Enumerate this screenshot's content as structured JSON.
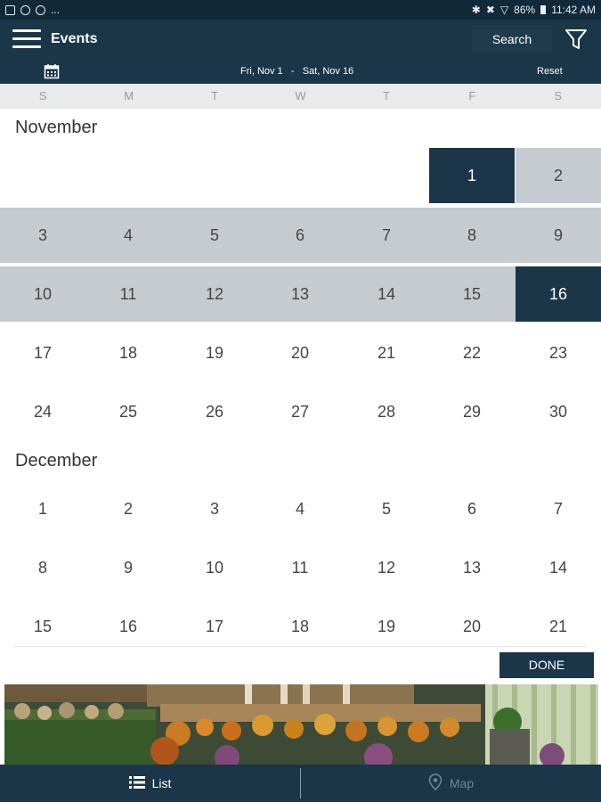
{
  "status_bar": {
    "left_text": "...",
    "battery": "86%",
    "time": "11:42 AM"
  },
  "header": {
    "title": "Events",
    "search_label": "Search"
  },
  "range_bar": {
    "start": "Fri, Nov 1",
    "separator": "-",
    "end": "Sat, Nov 16",
    "reset_label": "Reset"
  },
  "weekdays": [
    "S",
    "M",
    "T",
    "W",
    "T",
    "F",
    "S"
  ],
  "calendar": {
    "months": [
      {
        "name": "November",
        "weeks": [
          [
            "",
            "",
            "",
            "",
            "",
            "1",
            "2"
          ],
          [
            "3",
            "4",
            "5",
            "6",
            "7",
            "8",
            "9"
          ],
          [
            "10",
            "11",
            "12",
            "13",
            "14",
            "15",
            "16"
          ],
          [
            "17",
            "18",
            "19",
            "20",
            "21",
            "22",
            "23"
          ],
          [
            "24",
            "25",
            "26",
            "27",
            "28",
            "29",
            "30"
          ]
        ]
      },
      {
        "name": "December",
        "weeks": [
          [
            "1",
            "2",
            "3",
            "4",
            "5",
            "6",
            "7"
          ],
          [
            "8",
            "9",
            "10",
            "11",
            "12",
            "13",
            "14"
          ],
          [
            "15",
            "16",
            "17",
            "18",
            "19",
            "20",
            "21"
          ]
        ]
      }
    ],
    "selected_start": "Nov 1",
    "selected_end": "Nov 16"
  },
  "done_label": "DONE",
  "bottom_nav": {
    "list_label": "List",
    "map_label": "Map"
  },
  "colors": {
    "primary": "#1a3648",
    "range_fill": "#c6cbd0",
    "inactive_tab": "#6f8797"
  }
}
